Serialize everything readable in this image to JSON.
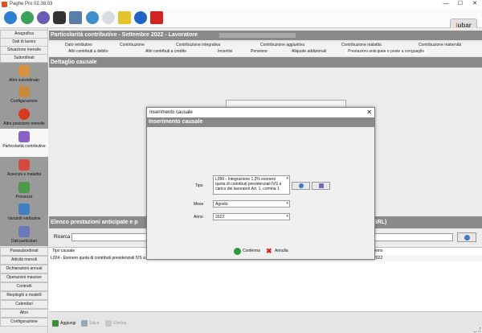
{
  "window": {
    "title": "Paghe Pro 02.38.03",
    "controls": [
      "—",
      "☐",
      "✕"
    ]
  },
  "logo": {
    "text_a": "i",
    "text_b": "ubar"
  },
  "sidebar": {
    "top_items": [
      "Anagrafica",
      "Dati di lavoro",
      "Situazione mensile",
      "Subordinati"
    ],
    "big_items": [
      {
        "label": "Altro subordinato",
        "icon": "person-icon"
      },
      {
        "label": "Configurazione",
        "icon": "person-gear-icon"
      },
      {
        "label": "Altra posizione mensile",
        "icon": "red-circle-icon"
      },
      {
        "label": "Particolarità contributive",
        "icon": "percent-icon"
      },
      {
        "label": "Assenza e malattia",
        "icon": "calendar-icon"
      },
      {
        "label": "Presenze",
        "icon": "calendar-check-icon"
      },
      {
        "label": "Variabili retributive",
        "icon": "chart-icon"
      },
      {
        "label": "Dati particolari",
        "icon": "people-icon"
      }
    ],
    "bottom_items": [
      "Parasubordinati",
      "Attività mensili",
      "Dichiarazioni annual",
      "Operazioni massive",
      "Contratti",
      "Riepiloghi e modelli",
      "Calendari",
      "Altro",
      "Configurazione"
    ]
  },
  "main": {
    "header": "Particolarità contributive - Settembre 2022 - Lavoratore",
    "tabs_row1": [
      "Dato retributivo",
      "Contribuzione",
      "Contribuzione integrativa",
      "Contribuzione aggiuntiva",
      "Contribuzione malattia",
      "Contribuzione maternità"
    ],
    "tabs_row2": [
      "Altri contributi a debito",
      "Altri contributi a credito",
      "Incentivi",
      "Pensione",
      "Aliquote addizionali",
      "Prestazioni anticipate e poste a conguaglio"
    ],
    "detail_header": "Dettaglio causale",
    "list_header_left": "Elenco prestazioni anticipate e p",
    "list_header_right": "SRL)",
    "search_label": "Ricerca",
    "grid_headers": [
      "Tipo causale",
      "Anno"
    ],
    "grid_row": [
      "L024 - Esonero quota di contributi previdenziali IVS a",
      "2022"
    ]
  },
  "bottom_bar": {
    "add": "Aggiungi",
    "save": "Salva",
    "delete": "Elimina"
  },
  "dialog": {
    "title": "Inserimento causale",
    "header": "Inserimento causale",
    "tipo_label": "Tipo",
    "tipo_value": "L096 - Integrazione 1,2% esonero quota di contributi previdenziali IVS a carico dei lavoratori Art. 1, comma 1",
    "mese_label": "Mese",
    "mese_value": "Agosto",
    "anno_label": "Anno",
    "anno_value": "2022",
    "confirm": "Conferma",
    "cancel": "Annulla"
  }
}
